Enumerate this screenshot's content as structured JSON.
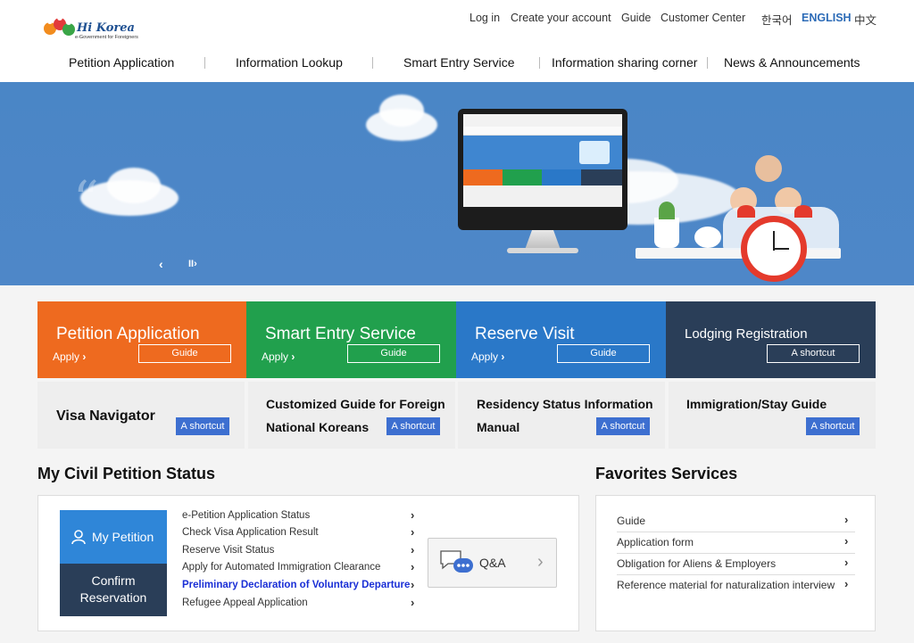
{
  "header": {
    "logo_text": "Hi Korea",
    "logo_sub": "e-Government for Foreigners",
    "util_links": [
      "Log in",
      "Create your account",
      "Guide",
      "Customer Center"
    ],
    "languages": [
      "한국어",
      "ENGLISH",
      "中文"
    ],
    "nav": [
      "Petition Application",
      "Information Lookup",
      "Smart Entry Service",
      "Information sharing corner",
      "News & Announcements"
    ]
  },
  "banner": {
    "prev_label": "‹",
    "pause_next_label": "II›",
    "quote": "“"
  },
  "tiles": [
    {
      "title": "Petition Application",
      "apply": "Apply",
      "guide": "Guide",
      "color": "#ee6a1f"
    },
    {
      "title": "Smart Entry Service",
      "apply": "Apply",
      "guide": "Guide",
      "color": "#21a04d"
    },
    {
      "title": "Reserve Visit",
      "apply": "Apply",
      "guide": "Guide",
      "color": "#2a78c8"
    },
    {
      "title": "Lodging Registration",
      "shortcut": "A shortcut",
      "color": "#2a3e58"
    }
  ],
  "sub_tiles": [
    {
      "title": "Visa Navigator",
      "shortcut": "A shortcut"
    },
    {
      "title_line1": "Customized Guide for Foreign",
      "title_line2": "National Koreans",
      "shortcut": "A shortcut"
    },
    {
      "title_line1": "Residency Status Information",
      "title_line2": "Manual",
      "shortcut": "A shortcut"
    },
    {
      "title": "Immigration/Stay Guide",
      "shortcut": "A shortcut"
    }
  ],
  "petition_status": {
    "title": "My Civil Petition Status",
    "my_petition": "My Petition",
    "confirm_line1": "Confirm",
    "confirm_line2": "Reservation",
    "items": [
      "e-Petition Application Status",
      "Check Visa Application Result",
      "Reserve Visit Status",
      "Apply for Automated Immigration Clearance",
      "Preliminary Declaration of Voluntary Departure",
      "Refugee Appeal Application"
    ],
    "qa_label": "Q&A"
  },
  "favorites": {
    "title": "Favorites Services",
    "items": [
      "Guide",
      "Application form",
      "Obligation for Aliens & Employers",
      "Reference material for naturalization interview"
    ]
  }
}
